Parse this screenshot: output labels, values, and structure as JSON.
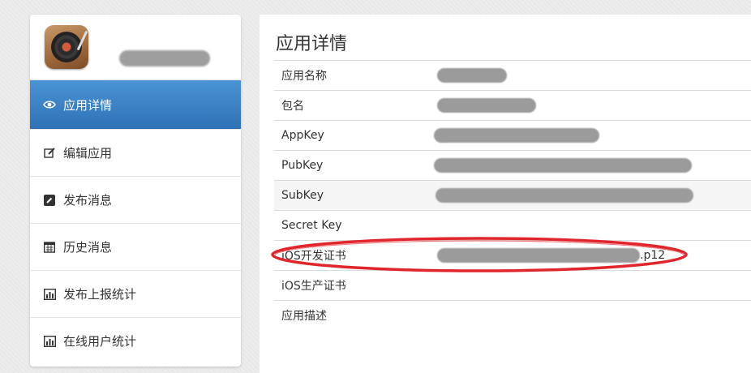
{
  "sidebar": {
    "items": [
      {
        "label": "应用详情",
        "icon": "eye-icon",
        "active": true
      },
      {
        "label": "编辑应用",
        "icon": "edit-icon",
        "active": false
      },
      {
        "label": "发布消息",
        "icon": "pencil-icon",
        "active": false
      },
      {
        "label": "历史消息",
        "icon": "calendar-icon",
        "active": false
      },
      {
        "label": "发布上报统计",
        "icon": "bar-chart-icon",
        "active": false
      },
      {
        "label": "在线用户统计",
        "icon": "bar-chart-icon",
        "active": false
      }
    ]
  },
  "main": {
    "title": "应用详情",
    "rows": [
      {
        "label": "应用名称"
      },
      {
        "label": "包名"
      },
      {
        "label": "AppKey"
      },
      {
        "label": "PubKey"
      },
      {
        "label": "SubKey"
      },
      {
        "label": "Secret Key",
        "value": ""
      },
      {
        "label": "iOS开发证书",
        "value_suffix": ".p12"
      },
      {
        "label": "iOS生产证书",
        "value": ""
      },
      {
        "label": "应用描述",
        "value": ""
      }
    ]
  },
  "colors": {
    "active_menu": "#3d86c8",
    "highlight_ellipse": "#e0262c",
    "redaction": "#9b9b9b"
  }
}
